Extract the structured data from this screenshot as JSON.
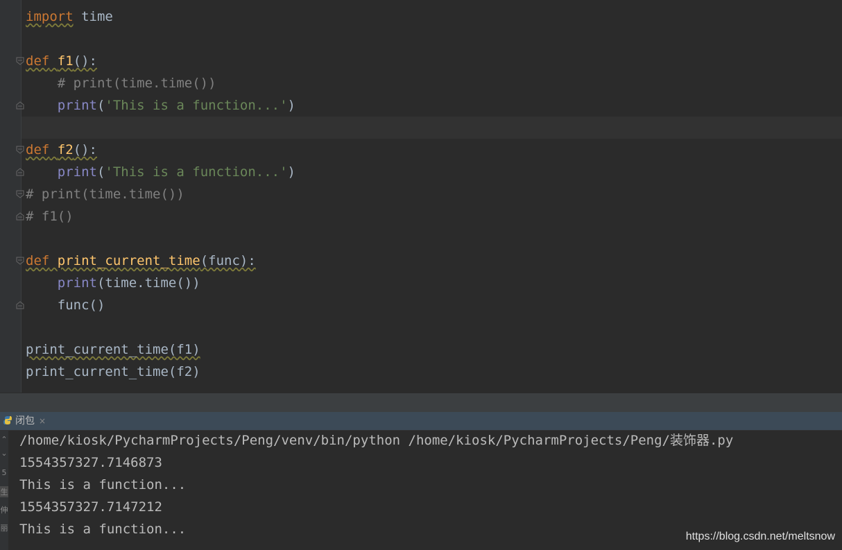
{
  "editor": {
    "l1": {
      "kw": "import",
      "rest": " time"
    },
    "l2": {
      "kw": "def",
      "fn": "f1",
      "rest": "():"
    },
    "l3": {
      "comment": "# print(time.time())"
    },
    "l4": {
      "bi": "print",
      "open": "(",
      "str": "'This is a function...'",
      "close": ")"
    },
    "l5": {
      "kw": "def",
      "fn": "f2",
      "rest": "():"
    },
    "l6": {
      "bi": "print",
      "open": "(",
      "str": "'This is a function...'",
      "close": ")"
    },
    "l7": {
      "comment": "# print(time.time())"
    },
    "l8": {
      "comment": "# f1()"
    },
    "l9": {
      "kw": "def",
      "fn": "print_current_time",
      "rest": "(func):"
    },
    "l10": {
      "bi": "print",
      "rest": "(time.time())"
    },
    "l11": {
      "rest": "func()"
    },
    "l12": {
      "rest": "print_current_time(f1)"
    },
    "l13": {
      "rest": "print_current_time(f2)"
    }
  },
  "run_tab": {
    "label": "闭包",
    "close": "×"
  },
  "console": {
    "gutter_marks": [
      "5",
      "生",
      "伸",
      "丽"
    ],
    "lines": [
      "/home/kiosk/PycharmProjects/Peng/venv/bin/python /home/kiosk/PycharmProjects/Peng/装饰器.py",
      "1554357327.7146873",
      "This is a function...",
      "1554357327.7147212",
      "This is a function..."
    ]
  },
  "watermark": "https://blog.csdn.net/meltsnow",
  "colors": {
    "keyword": "#cc7832",
    "function": "#ffc66d",
    "builtin": "#8888c6",
    "string": "#6a8759",
    "comment": "#808080"
  }
}
